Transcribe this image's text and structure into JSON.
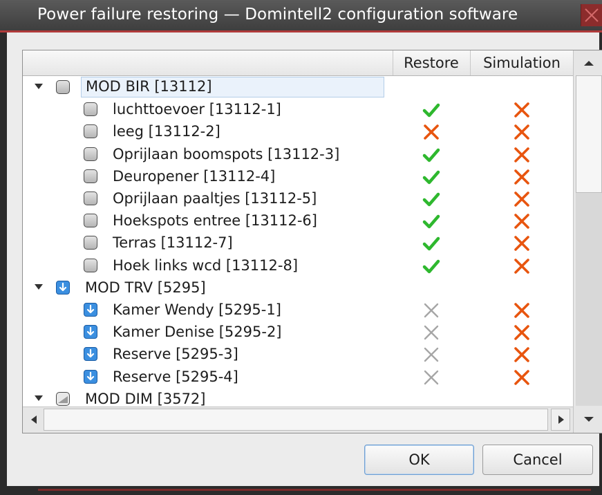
{
  "window": {
    "title": "Power failure restoring — Domintell2 configuration software"
  },
  "columns": {
    "name": "",
    "restore": "Restore",
    "simulation": "Simulation"
  },
  "colors": {
    "check": "#2eb82e",
    "cross_orange": "#e8550f",
    "cross_grey": "#a6a6a6"
  },
  "rows": [
    {
      "label": "MOD BIR [13112]",
      "level": 0,
      "icon": "module-grey-icon",
      "restore": "",
      "simulation": ""
    },
    {
      "label": "luchttoevoer [13112-1]",
      "level": 1,
      "icon": "module-grey-icon",
      "restore": "check",
      "simulation": "cross"
    },
    {
      "label": "leeg [13112-2]",
      "level": 1,
      "icon": "module-grey-icon",
      "restore": "cross",
      "simulation": "cross"
    },
    {
      "label": "Oprijlaan boomspots [13112-3]",
      "level": 1,
      "icon": "module-grey-icon",
      "restore": "check",
      "simulation": "cross"
    },
    {
      "label": "Deuropener [13112-4]",
      "level": 1,
      "icon": "module-grey-icon",
      "restore": "check",
      "simulation": "cross"
    },
    {
      "label": "Oprijlaan paaltjes [13112-5]",
      "level": 1,
      "icon": "module-grey-icon",
      "restore": "check",
      "simulation": "cross"
    },
    {
      "label": "Hoekspots entree [13112-6]",
      "level": 1,
      "icon": "module-grey-icon",
      "restore": "check",
      "simulation": "cross"
    },
    {
      "label": "Terras [13112-7]",
      "level": 1,
      "icon": "module-grey-icon",
      "restore": "check",
      "simulation": "cross"
    },
    {
      "label": "Hoek links wcd [13112-8]",
      "level": 1,
      "icon": "module-grey-icon",
      "restore": "check",
      "simulation": "cross"
    },
    {
      "label": "MOD TRV [5295]",
      "level": 0,
      "icon": "thermostat-blue-icon",
      "restore": "",
      "simulation": ""
    },
    {
      "label": "Kamer Wendy [5295-1]",
      "level": 1,
      "icon": "thermostat-blue-icon",
      "restore": "cross-disabled",
      "simulation": "cross"
    },
    {
      "label": "Kamer Denise [5295-2]",
      "level": 1,
      "icon": "thermostat-blue-icon",
      "restore": "cross-disabled",
      "simulation": "cross"
    },
    {
      "label": "Reserve [5295-3]",
      "level": 1,
      "icon": "thermostat-blue-icon",
      "restore": "cross-disabled",
      "simulation": "cross"
    },
    {
      "label": "Reserve [5295-4]",
      "level": 1,
      "icon": "thermostat-blue-icon",
      "restore": "cross-disabled",
      "simulation": "cross"
    },
    {
      "label": "MOD DIM [3572]",
      "level": 0,
      "icon": "dimmer-icon",
      "restore": "",
      "simulation": ""
    }
  ],
  "buttons": {
    "ok": "OK",
    "cancel": "Cancel"
  }
}
